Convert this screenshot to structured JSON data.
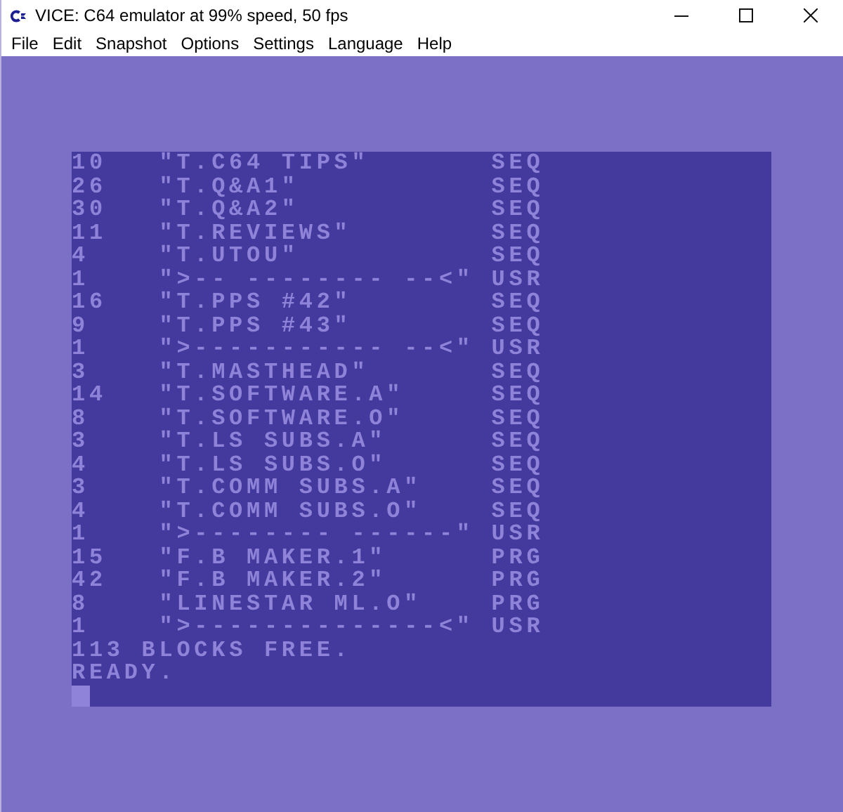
{
  "window": {
    "title": "VICE: C64 emulator at 99% speed, 50 fps"
  },
  "menu": [
    "File",
    "Edit",
    "Snapshot",
    "Options",
    "Settings",
    "Language",
    "Help"
  ],
  "directory": [
    {
      "blocks": "10",
      "name": "\"T.C64 TIPS\"",
      "type": "SEQ"
    },
    {
      "blocks": "26",
      "name": "\"T.Q&A1\"",
      "type": "SEQ"
    },
    {
      "blocks": "30",
      "name": "\"T.Q&A2\"",
      "type": "SEQ"
    },
    {
      "blocks": "11",
      "name": "\"T.REVIEWS\"",
      "type": "SEQ"
    },
    {
      "blocks": "4",
      "name": "\"T.UTOU\"",
      "type": "SEQ"
    },
    {
      "blocks": "1",
      "name": "\">-- -------- --<\"",
      "type": "USR"
    },
    {
      "blocks": "16",
      "name": "\"T.PPS #42\"",
      "type": "SEQ"
    },
    {
      "blocks": "9",
      "name": "\"T.PPS #43\"",
      "type": "SEQ"
    },
    {
      "blocks": "1",
      "name": "\">----------- --<\"",
      "type": "USR"
    },
    {
      "blocks": "3",
      "name": "\"T.MASTHEAD\"",
      "type": "SEQ"
    },
    {
      "blocks": "14",
      "name": "\"T.SOFTWARE.A\"",
      "type": "SEQ"
    },
    {
      "blocks": "8",
      "name": "\"T.SOFTWARE.O\"",
      "type": "SEQ"
    },
    {
      "blocks": "3",
      "name": "\"T.LS SUBS.A\"",
      "type": "SEQ"
    },
    {
      "blocks": "4",
      "name": "\"T.LS SUBS.O\"",
      "type": "SEQ"
    },
    {
      "blocks": "3",
      "name": "\"T.COMM SUBS.A\"",
      "type": "SEQ"
    },
    {
      "blocks": "4",
      "name": "\"T.COMM SUBS.O\"",
      "type": "SEQ"
    },
    {
      "blocks": "1",
      "name": "\">-------- ------\"",
      "type": "USR"
    },
    {
      "blocks": "15",
      "name": "\"F.B MAKER.1\"",
      "type": "PRG"
    },
    {
      "blocks": "42",
      "name": "\"F.B MAKER.2\"",
      "type": "PRG"
    },
    {
      "blocks": "8",
      "name": "\"LINESTAR ML.O\"",
      "type": "PRG"
    },
    {
      "blocks": "1",
      "name": "\">--------------<\"",
      "type": "USR"
    }
  ],
  "messages": [
    "113 BLOCKS FREE.",
    "READY."
  ]
}
